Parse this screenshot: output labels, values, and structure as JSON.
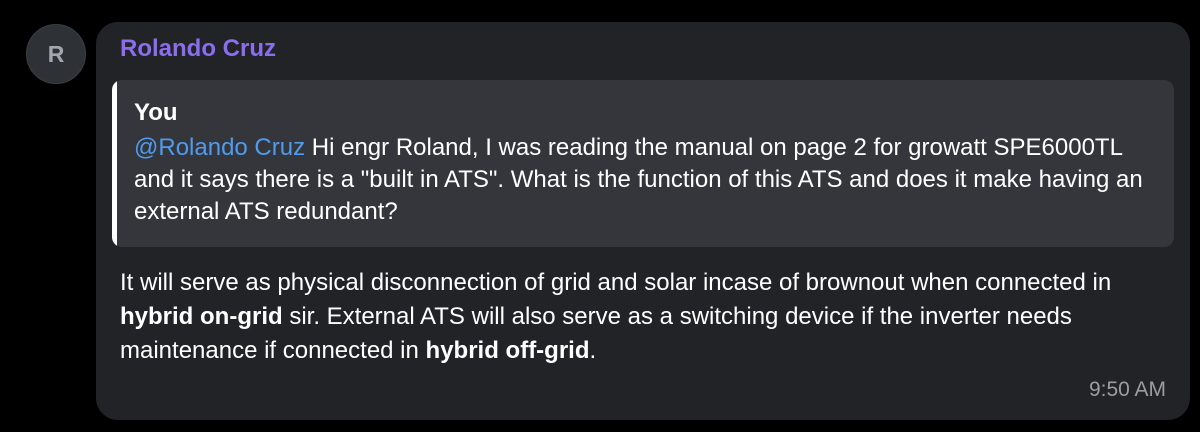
{
  "avatar": {
    "initial": "R",
    "color": "#2e3135"
  },
  "message": {
    "sender": "Rolando Cruz",
    "sender_color": "#8b6ef0",
    "reply": {
      "author": "You",
      "mention": "@Rolando Cruz",
      "mention_color": "#4f9bed",
      "text": " Hi engr Roland, I was reading the manual on page 2 for growatt SPE6000TL and it says there is a \"built in ATS\". What is the function of this ATS and does it make having an external ATS redundant?"
    },
    "body": {
      "part1": "It will serve as physical disconnection of grid and solar incase of brownout when connected in ",
      "bold1": "hybrid on-grid",
      "part2": " sir. External ATS will also serve as a switching device if the inverter needs maintenance if connected in ",
      "bold2": "hybrid off-grid",
      "part3": "."
    },
    "time": "9:50 AM"
  }
}
